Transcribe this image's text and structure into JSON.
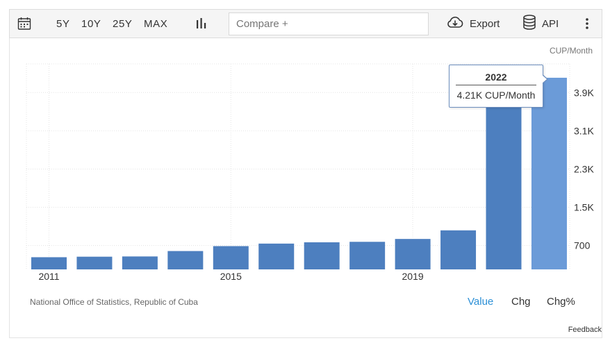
{
  "toolbar": {
    "ranges": [
      "5Y",
      "10Y",
      "25Y",
      "MAX"
    ],
    "compare_placeholder": "Compare +",
    "export_label": "Export",
    "api_label": "API"
  },
  "unit_label": "CUP/Month",
  "tooltip": {
    "year": "2022",
    "value": "4.21K CUP/Month"
  },
  "source": "National Office of Statistics, Republic of Cuba",
  "view_tabs": {
    "value": "Value",
    "chg": "Chg",
    "chgpct": "Chg%"
  },
  "feedback": "Feedback",
  "colors": {
    "bar": "#4d7fbf",
    "bar_highlight": "#6b9bd8",
    "active_tab": "#2b8fd6"
  },
  "chart_data": {
    "type": "bar",
    "categories": [
      "2011",
      "2012",
      "2013",
      "2014",
      "2015",
      "2016",
      "2017",
      "2018",
      "2019",
      "2020",
      "2021",
      "2022"
    ],
    "values": [
      455,
      466,
      471,
      584,
      687,
      740,
      767,
      777,
      837,
      1017,
      3838,
      4210
    ],
    "x_tick_labels": [
      "2011",
      "2015",
      "2019"
    ],
    "y_ticks": [
      700,
      1500,
      2300,
      3100,
      3900
    ],
    "y_tick_labels": [
      "700",
      "1.5K",
      "2.3K",
      "3.1K",
      "3.9K"
    ],
    "ylabel": "CUP/Month",
    "ylim": [
      200,
      4500
    ],
    "grid": true,
    "highlighted": "2022"
  }
}
